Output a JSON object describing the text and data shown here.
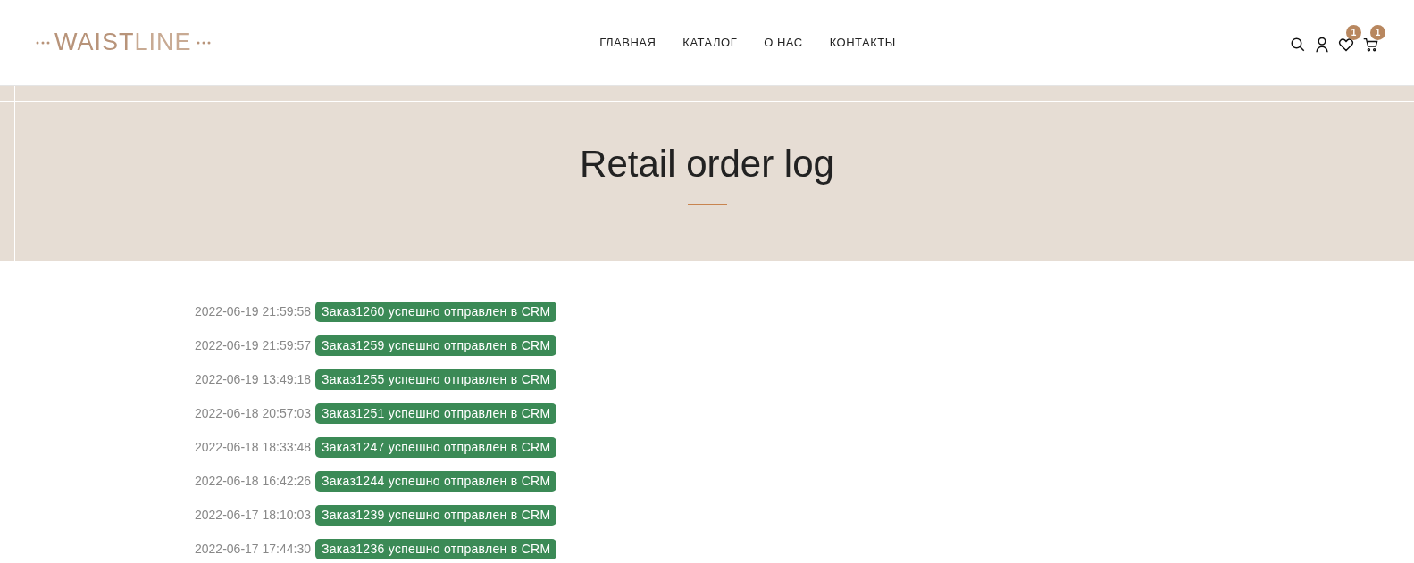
{
  "logo": {
    "bold_part": "WAIST",
    "light_part": "LINE"
  },
  "nav": [
    {
      "label": "ГЛАВНАЯ"
    },
    {
      "label": "КАТАЛОГ"
    },
    {
      "label": "О НАС"
    },
    {
      "label": "КОНТАКТЫ"
    }
  ],
  "header_icons": {
    "wishlist_count": "1",
    "cart_count": "1"
  },
  "banner": {
    "title": "Retail order log"
  },
  "log": [
    {
      "time": "2022-06-19 21:59:58",
      "message": "Заказ1260 успешно отправлен в CRM",
      "color": "#3b8a56"
    },
    {
      "time": "2022-06-19 21:59:57",
      "message": "Заказ1259 успешно отправлен в CRM",
      "color": "#3b8a56"
    },
    {
      "time": "2022-06-19 13:49:18",
      "message": "Заказ1255 успешно отправлен в CRM",
      "color": "#3b8a56"
    },
    {
      "time": "2022-06-18 20:57:03",
      "message": "Заказ1251 успешно отправлен в CRM",
      "color": "#3b8a56"
    },
    {
      "time": "2022-06-18 18:33:48",
      "message": "Заказ1247 успешно отправлен в CRM",
      "color": "#3b8a56"
    },
    {
      "time": "2022-06-18 16:42:26",
      "message": "Заказ1244 успешно отправлен в CRM",
      "color": "#3b8a56"
    },
    {
      "time": "2022-06-17 18:10:03",
      "message": "Заказ1239 успешно отправлен в CRM",
      "color": "#3b8a56"
    },
    {
      "time": "2022-06-17 17:44:30",
      "message": "Заказ1236 успешно отправлен в CRM",
      "color": "#3b8a56"
    }
  ]
}
